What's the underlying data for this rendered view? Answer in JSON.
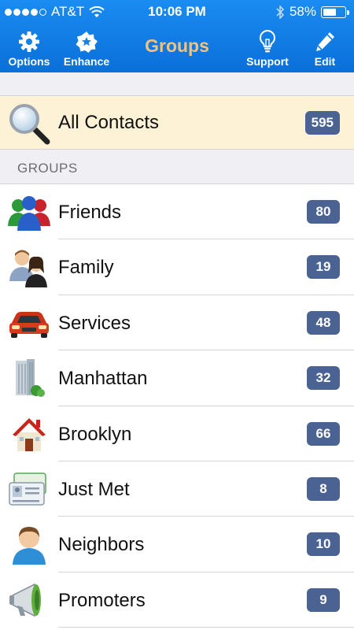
{
  "status_bar": {
    "carrier": "AT&T",
    "time": "10:06 PM",
    "battery": "58%",
    "battery_level": 0.58
  },
  "nav": {
    "title": "Groups",
    "options_label": "Options",
    "enhance_label": "Enhance",
    "support_label": "Support",
    "edit_label": "Edit"
  },
  "all_contacts": {
    "label": "All Contacts",
    "count": "595",
    "icon": "magnifier-icon"
  },
  "section_header": "GROUPS",
  "groups": [
    {
      "label": "Friends",
      "count": "80",
      "icon": "people-group-icon"
    },
    {
      "label": "Family",
      "count": "19",
      "icon": "family-icon"
    },
    {
      "label": "Services",
      "count": "48",
      "icon": "car-icon"
    },
    {
      "label": "Manhattan",
      "count": "32",
      "icon": "building-icon"
    },
    {
      "label": "Brooklyn",
      "count": "66",
      "icon": "house-icon"
    },
    {
      "label": "Just Met",
      "count": "8",
      "icon": "business-card-icon"
    },
    {
      "label": "Neighbors",
      "count": "10",
      "icon": "person-icon"
    },
    {
      "label": "Promoters",
      "count": "9",
      "icon": "megaphone-icon"
    }
  ],
  "colors": {
    "nav_bar": "#1a8cf2",
    "title": "#f4c27a",
    "badge": "#4a6393",
    "all_contacts_bg": "#fdf2d5",
    "section_bg": "#efeff4"
  }
}
